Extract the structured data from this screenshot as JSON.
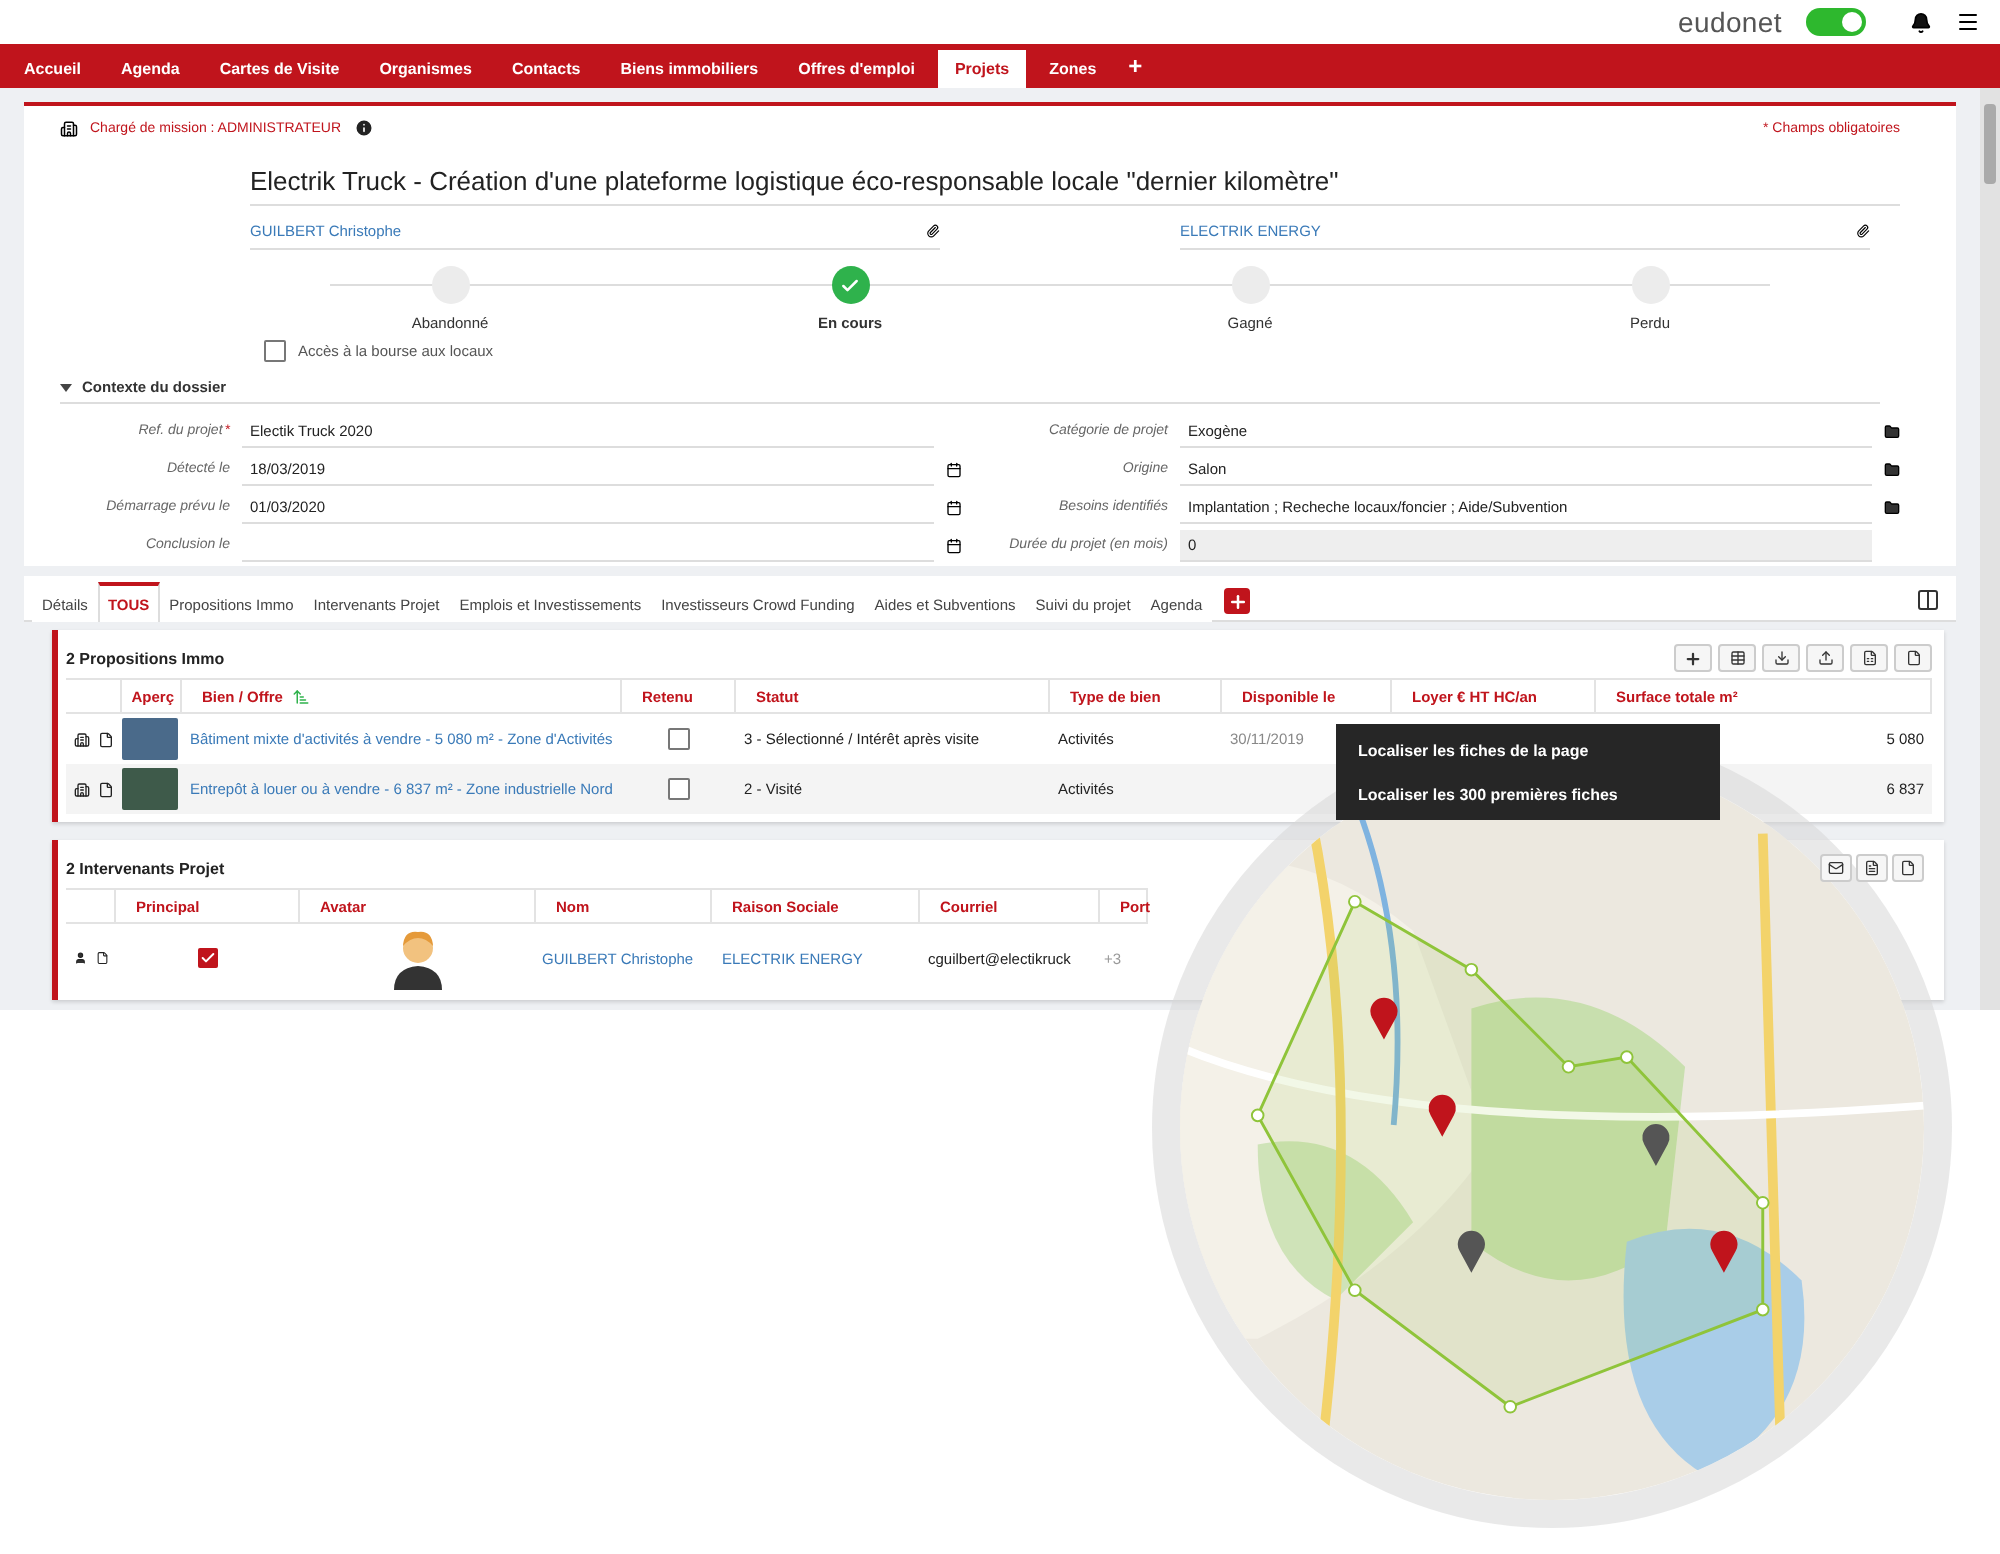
{
  "top_bar": {
    "logo": "eudonet",
    "toggle_on": true
  },
  "nav": [
    {
      "label": "Accueil",
      "selected": false
    },
    {
      "label": "Agenda",
      "selected": false
    },
    {
      "label": "Cartes de Visite",
      "selected": false
    },
    {
      "label": "Organismes",
      "selected": false
    },
    {
      "label": "Contacts",
      "selected": false
    },
    {
      "label": "Biens immobiliers",
      "selected": false
    },
    {
      "label": "Offres d'emploi",
      "selected": false
    },
    {
      "label": "Projets",
      "selected": true
    },
    {
      "label": "Zones",
      "selected": false
    }
  ],
  "nav_add": "+",
  "record": {
    "owner": "Chargé de mission : ADMINISTRATEUR",
    "required_note": "* Champs obligatoires",
    "title": "Electrik Truck - Création d'une plateforme logistique éco-responsable locale \"dernier kilomètre\"",
    "contact": "GUILBERT Christophe",
    "company": "ELECTRIK ENERGY",
    "steps": [
      {
        "label": "Abandonné",
        "selected": false
      },
      {
        "label": "En cours",
        "selected": true
      },
      {
        "label": "Gagné",
        "selected": false
      },
      {
        "label": "Perdu",
        "selected": false
      }
    ],
    "bourse": {
      "label": "Accès à la bourse aux locaux",
      "checked": false
    },
    "section": {
      "title": "Contexte du dossier",
      "expanded": true
    },
    "fields_left": [
      {
        "label": "Ref. du projet",
        "mark": "*",
        "value": "Electik Truck 2020",
        "kind": "text"
      },
      {
        "label": "Détecté le",
        "value": "18/03/2019",
        "kind": "date"
      },
      {
        "label": "Démarrage prévu le",
        "value": "01/03/2020",
        "kind": "date"
      },
      {
        "label": "Conclusion le",
        "kind": "date"
      }
    ],
    "fields_right": [
      {
        "label": "Catégorie de projet",
        "value": "Exogène",
        "kind": "catalog"
      },
      {
        "label": "Origine",
        "value": "Salon",
        "kind": "catalog"
      },
      {
        "label": "Besoins identifiés",
        "value": "Implantation ; Recheche locaux/foncier ; Aide/Subvention",
        "kind": "catalog"
      },
      {
        "label": "Durée du projet (en mois)",
        "value": "0",
        "kind": "readonly"
      }
    ]
  },
  "tabs": [
    {
      "label": "Détails",
      "selected": false
    },
    {
      "label": "TOUS",
      "selected": true
    },
    {
      "label": "Propositions Immo",
      "selected": false
    },
    {
      "label": "Intervenants Projet",
      "selected": false
    },
    {
      "label": "Emplois et Investissements",
      "selected": false
    },
    {
      "label": "Investisseurs Crowd Funding",
      "selected": false
    },
    {
      "label": "Aides et Subventions",
      "selected": false
    },
    {
      "label": "Suivi du projet",
      "selected": false
    },
    {
      "label": "Agenda",
      "selected": false
    }
  ],
  "propositions": {
    "title": "2 Propositions Immo",
    "columns": [
      "Aperç",
      "Bien / Offre",
      "Retenu",
      "Statut",
      "Type de bien",
      "Disponible le",
      "Loyer € HT HC/an",
      "Surface totale m²"
    ],
    "rows": [
      {
        "offer": "Bâtiment mixte d'activités à vendre - 5 080 m² - Zone d'Activités",
        "retenu": false,
        "statut": "3 - Sélectionné / Intérêt après visite",
        "type": "Activités",
        "disponible": "30/11/2019",
        "surface": "5 080"
      },
      {
        "offer": "Entrepôt à louer ou à vendre - 6 837 m² - Zone industrielle Nord",
        "retenu": false,
        "statut": "2 - Visité",
        "type": "Activités",
        "surface": "6 837"
      }
    ]
  },
  "intervenants": {
    "title": "2 Intervenants Projet",
    "columns": [
      "Principal",
      "Avatar",
      "Nom",
      "Raison Sociale",
      "Courriel",
      "Port"
    ],
    "rows": [
      {
        "principal": true,
        "nom": "GUILBERT Christophe",
        "raison": "ELECTRIK ENERGY",
        "courriel": "cguilbert@electikruck",
        "port": "+3"
      }
    ]
  },
  "map_menu": [
    "Localiser les fiches de la page",
    "Localiser les 300 premières fiches"
  ]
}
